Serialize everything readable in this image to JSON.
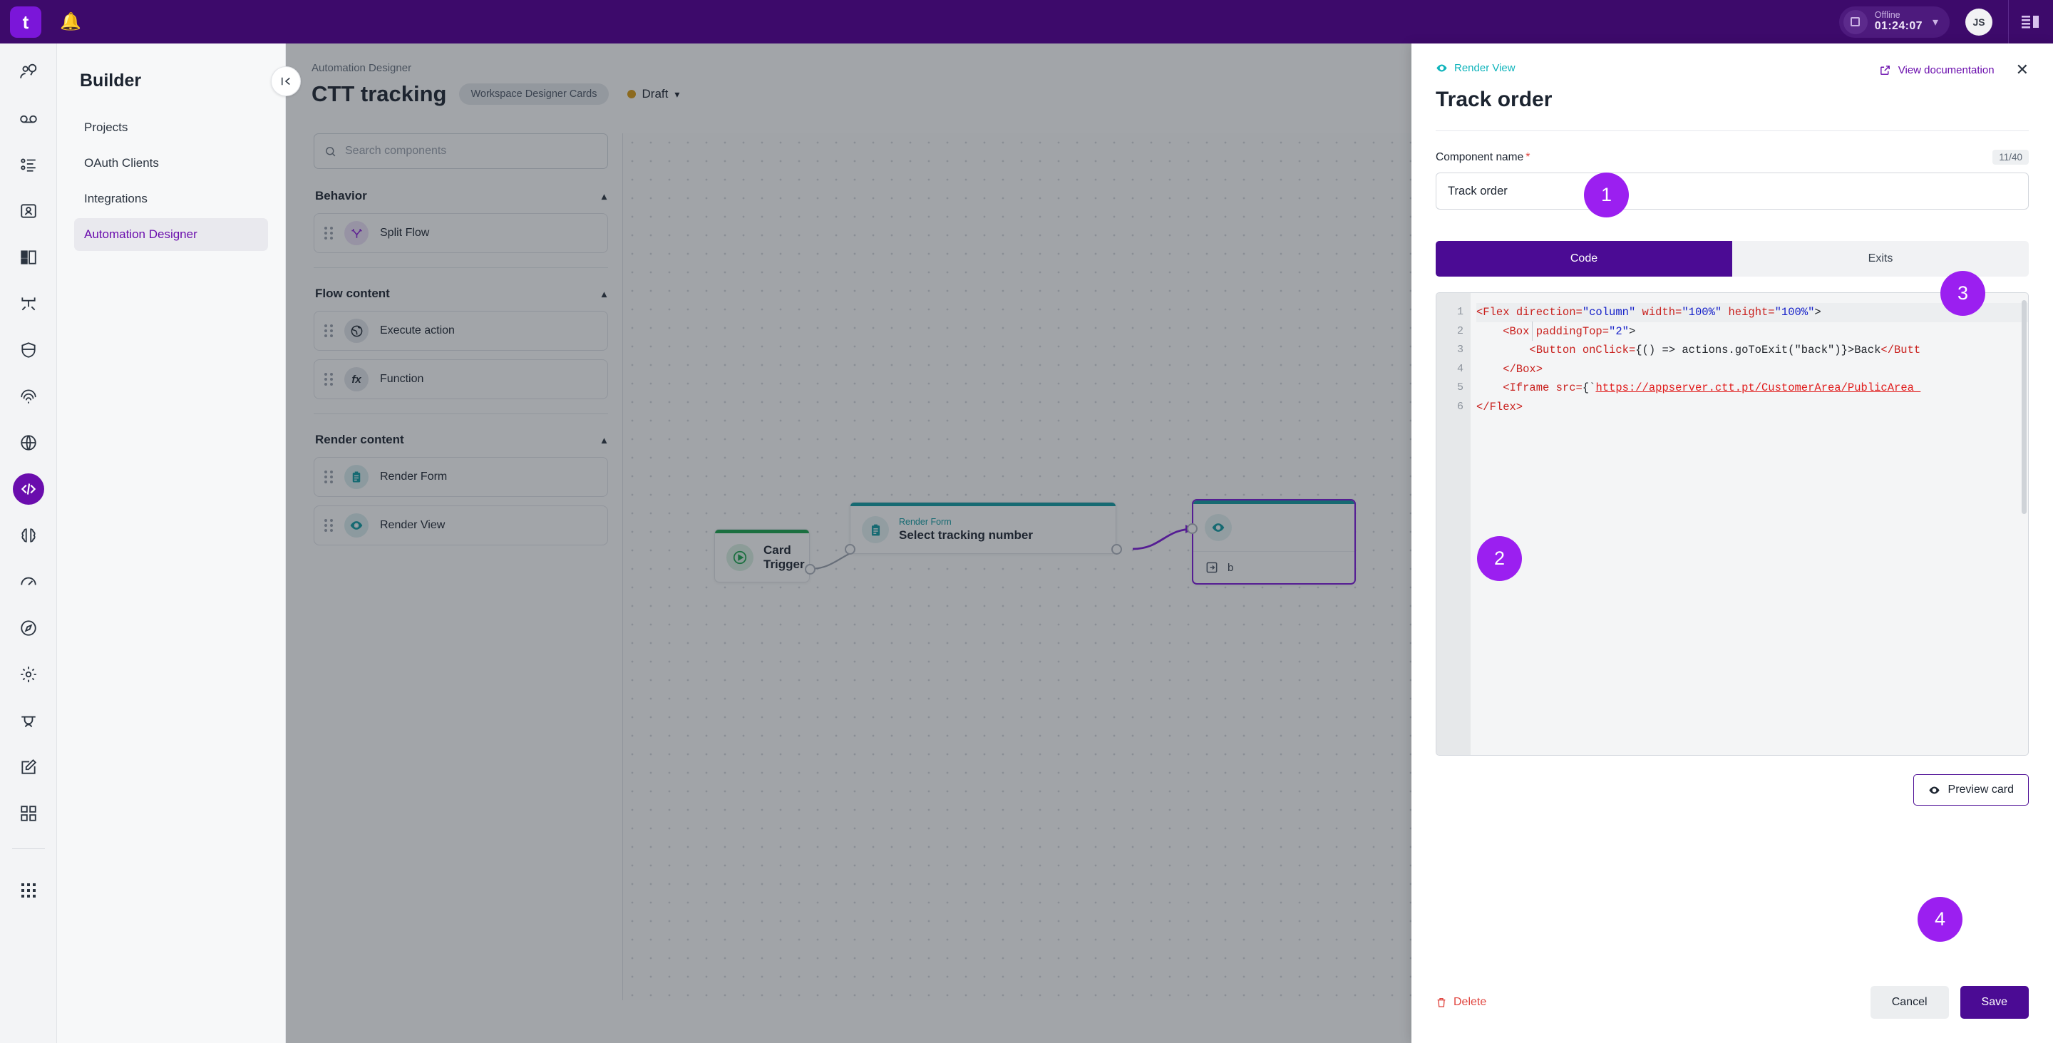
{
  "topbar": {
    "logo_glyph": "t",
    "bell_icon": "bell-icon",
    "status_label": "Offline",
    "timer": "01:24:07",
    "avatar_initials": "JS"
  },
  "rail": {
    "items": [
      {
        "icon": "agent-chat-icon",
        "active": false
      },
      {
        "icon": "voicemail-icon",
        "active": false
      },
      {
        "icon": "queue-list-icon",
        "active": false
      },
      {
        "icon": "contacts-icon",
        "active": false
      },
      {
        "icon": "dashboard-layout-icon",
        "active": false
      },
      {
        "icon": "routing-flow-icon",
        "active": false
      },
      {
        "icon": "shield-icon",
        "active": false
      },
      {
        "icon": "fingerprint-icon",
        "active": false
      },
      {
        "icon": "globe-icon",
        "active": false
      },
      {
        "icon": "code-icon",
        "active": true
      },
      {
        "icon": "brain-icon",
        "active": false
      },
      {
        "icon": "gauge-icon",
        "active": false
      },
      {
        "icon": "compass-icon",
        "active": false
      },
      {
        "icon": "gear-icon",
        "active": false
      },
      {
        "icon": "graduation-cap-icon",
        "active": false
      },
      {
        "icon": "edit-square-icon",
        "active": false
      },
      {
        "icon": "apps-grid-icon",
        "active": false
      }
    ],
    "bottom_icon": "app-launcher-icon"
  },
  "builder_nav": {
    "title": "Builder",
    "items": [
      {
        "label": "Projects",
        "active": false
      },
      {
        "label": "OAuth Clients",
        "active": false
      },
      {
        "label": "Integrations",
        "active": false
      },
      {
        "label": "Automation Designer",
        "active": true
      }
    ]
  },
  "workspace": {
    "collapse_icon": "collapse-panel-icon",
    "breadcrumb": "Automation Designer",
    "title": "CTT tracking",
    "chip": "Workspace Designer Cards",
    "status": "Draft",
    "status_color": "#d99a12"
  },
  "components": {
    "search_placeholder": "Search components",
    "search_icon": "search-icon",
    "groups": [
      {
        "title": "Behavior",
        "items": [
          {
            "label": "Split Flow",
            "icon": "split-flow-icon",
            "tone": "purple"
          }
        ]
      },
      {
        "title": "Flow content",
        "items": [
          {
            "label": "Execute action",
            "icon": "globe-action-icon",
            "tone": "dark"
          },
          {
            "label": "Function",
            "icon": "function-fx-icon",
            "tone": "dark"
          }
        ]
      },
      {
        "title": "Render content",
        "items": [
          {
            "label": "Render Form",
            "icon": "clipboard-form-icon",
            "tone": "teal"
          },
          {
            "label": "Render View",
            "icon": "eye-view-icon",
            "tone": "teal"
          }
        ]
      }
    ]
  },
  "canvas": {
    "nodes": [
      {
        "name": "Card Trigger",
        "kicker": "",
        "icon": "play-trigger-icon",
        "bar_color": "#17a34a"
      },
      {
        "name": "Select tracking number",
        "kicker": "Render Form",
        "icon": "clipboard-form-icon",
        "bar_color": "#0e9aa0"
      },
      {
        "name": "",
        "kicker": "",
        "icon": "eye-view-icon",
        "bar_color": "#0e9aa0",
        "exit_label": "b"
      }
    ]
  },
  "drawer": {
    "kicker": "Render View",
    "kicker_icon": "eye-view-icon",
    "title": "Track order",
    "docs_link": "View documentation",
    "docs_icon": "external-link-icon",
    "close_icon": "close-icon",
    "field_label": "Component name",
    "required_mark": "*",
    "counter": "11/40",
    "name_value": "Track order",
    "tabs": [
      {
        "label": "Code",
        "active": true
      },
      {
        "label": "Exits",
        "active": false
      }
    ],
    "editor": {
      "line_numbers": [
        "1",
        "2",
        "3",
        "4",
        "5",
        "6"
      ],
      "lines": [
        [
          {
            "t": "<Flex ",
            "c": "tag"
          },
          {
            "t": "direction=",
            "c": "attr"
          },
          {
            "t": "\"column\" ",
            "c": "str"
          },
          {
            "t": "width=",
            "c": "attr"
          },
          {
            "t": "\"100%\" ",
            "c": "str"
          },
          {
            "t": "height=",
            "c": "attr"
          },
          {
            "t": "\"100%\"",
            "c": "str"
          },
          {
            "t": ">",
            "c": "plain"
          }
        ],
        [
          {
            "t": "    <Box ",
            "c": "tag"
          },
          {
            "t": "paddingTop=",
            "c": "attr"
          },
          {
            "t": "\"2\"",
            "c": "str"
          },
          {
            "t": ">",
            "c": "plain"
          }
        ],
        [
          {
            "t": "        <Button ",
            "c": "tag"
          },
          {
            "t": "onClick=",
            "c": "attr"
          },
          {
            "t": "{() => actions.goToExit(\"back\")}>Back",
            "c": "plain"
          },
          {
            "t": "</Butt",
            "c": "tag"
          }
        ],
        [
          {
            "t": "    </Box>",
            "c": "tag"
          }
        ],
        [
          {
            "t": "    <Iframe ",
            "c": "tag"
          },
          {
            "t": "src=",
            "c": "attr"
          },
          {
            "t": "{`",
            "c": "plain"
          },
          {
            "t": "https://appserver.ctt.pt/CustomerArea/PublicArea_",
            "c": "url"
          }
        ],
        [
          {
            "t": "</Flex>",
            "c": "tag"
          }
        ]
      ]
    },
    "preview_button": "Preview card",
    "preview_icon": "eye-view-icon",
    "delete_button": "Delete",
    "delete_icon": "trash-icon",
    "cancel_button": "Cancel",
    "save_button": "Save"
  },
  "annotations": [
    {
      "number": "1"
    },
    {
      "number": "2"
    },
    {
      "number": "3"
    },
    {
      "number": "4"
    }
  ]
}
